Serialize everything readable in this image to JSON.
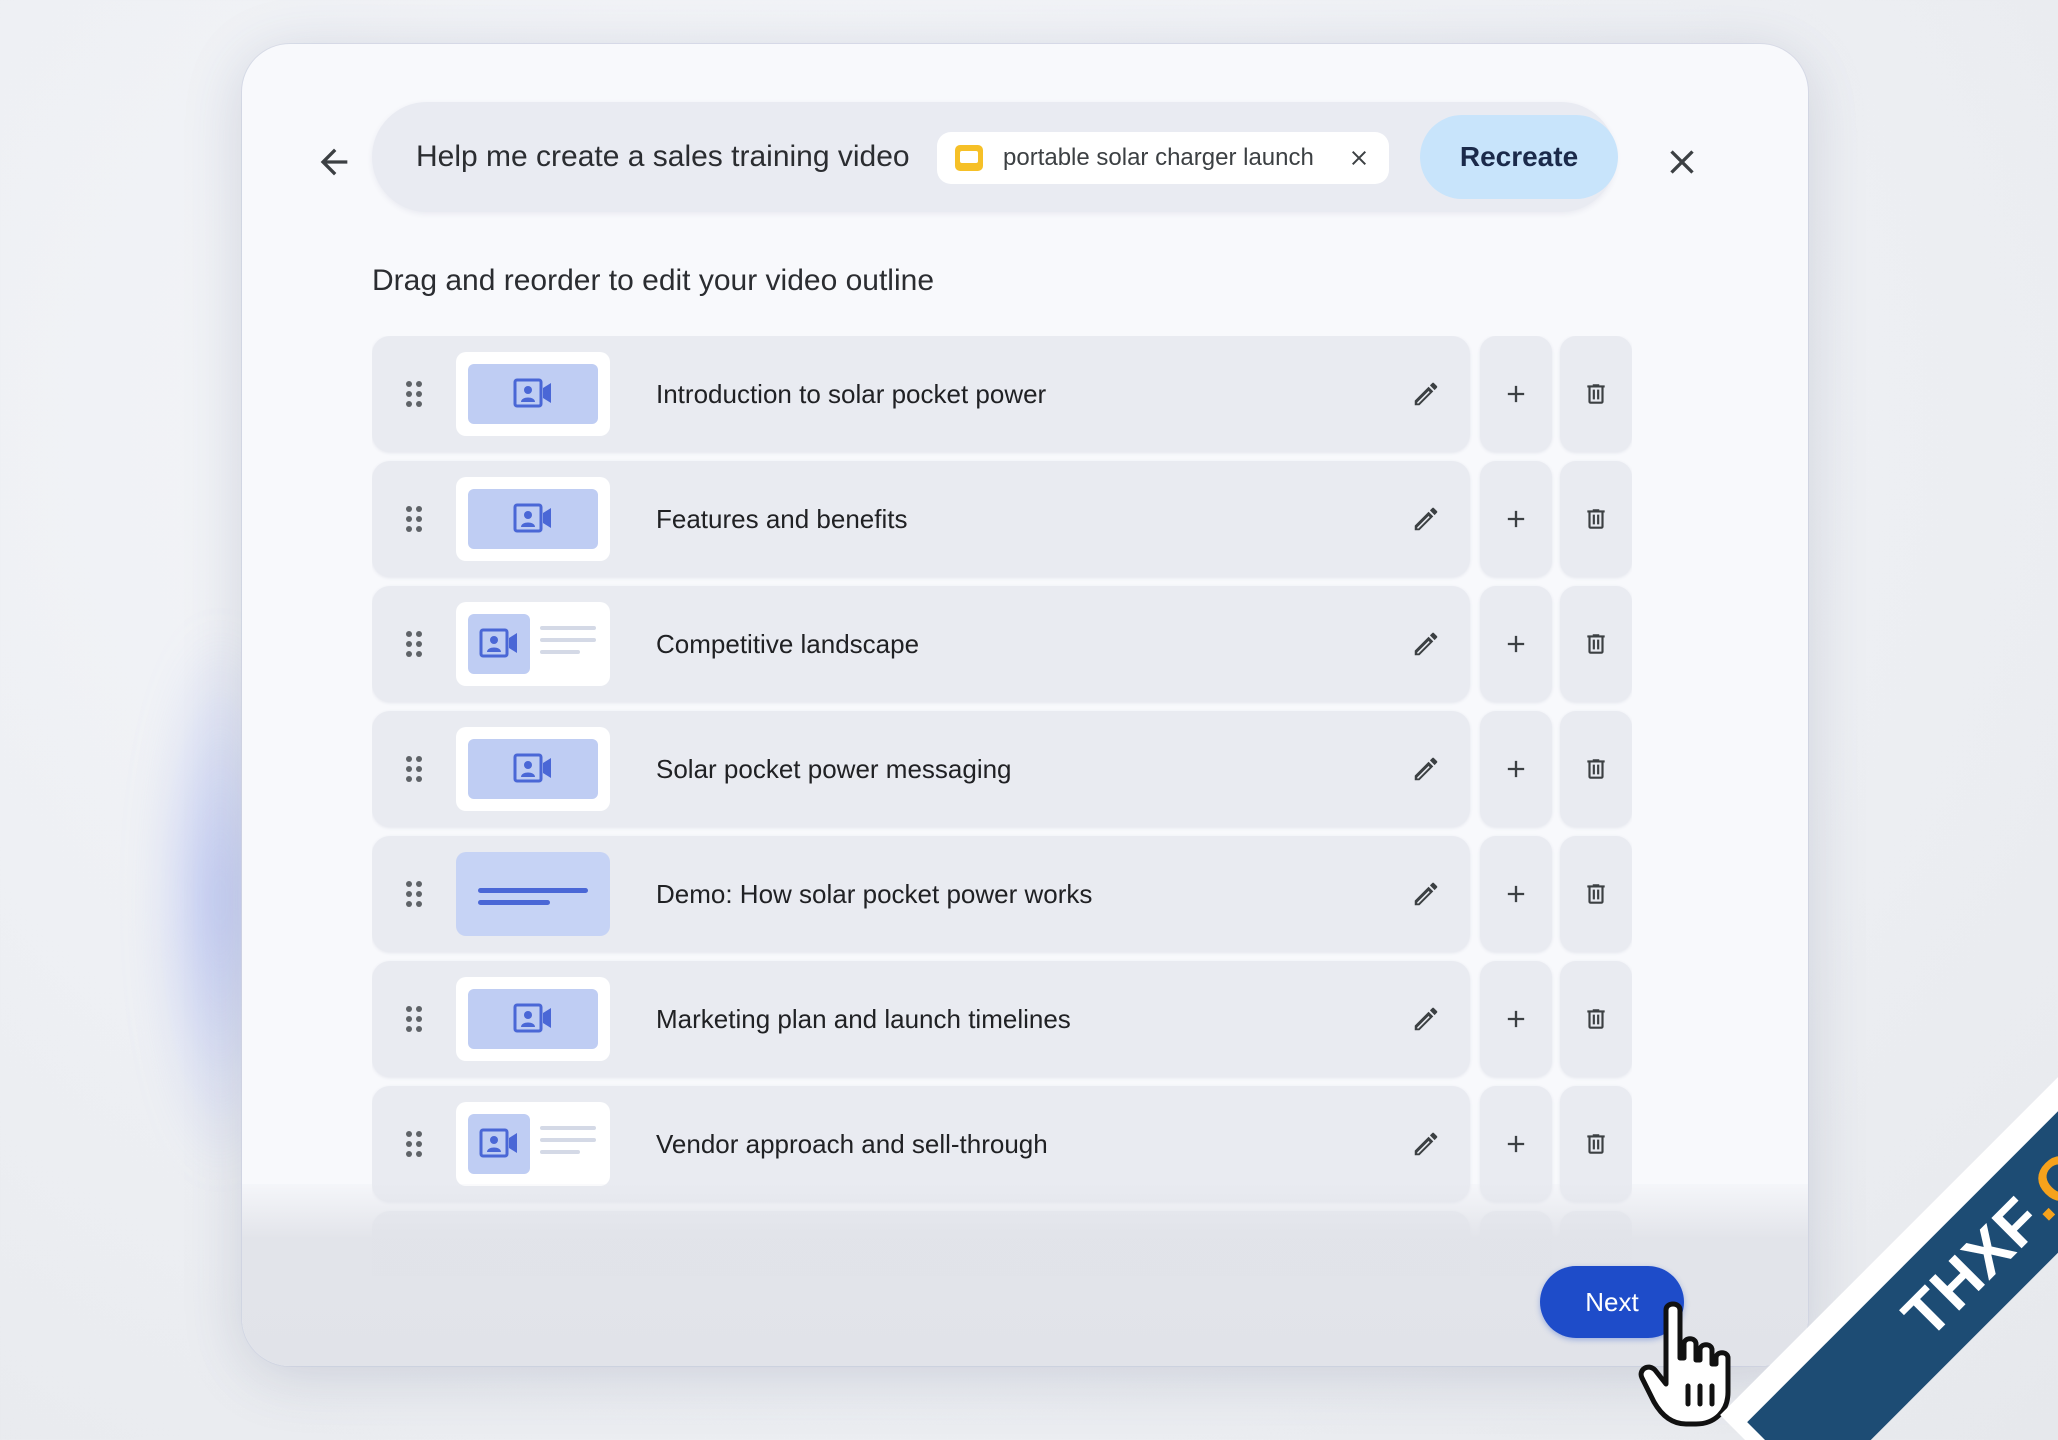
{
  "prompt_bar": {
    "text": "Help me create a sales training video",
    "chip_label": "portable solar charger launch",
    "recreate_label": "Recreate"
  },
  "heading": "Drag and reorder to edit your video outline",
  "outline_items": [
    {
      "title": "Introduction to solar pocket power",
      "thumb": "video-full"
    },
    {
      "title": "Features and benefits",
      "thumb": "video-full"
    },
    {
      "title": "Competitive landscape",
      "thumb": "video-with-text"
    },
    {
      "title": "Solar pocket power messaging",
      "thumb": "video-full"
    },
    {
      "title": "Demo: How solar pocket power works",
      "thumb": "slide-lines"
    },
    {
      "title": "Marketing plan and launch timelines",
      "thumb": "video-full"
    },
    {
      "title": "Vendor approach and sell-through",
      "thumb": "video-with-text"
    }
  ],
  "next_label": "Next",
  "watermark": {
    "main": "THXF",
    "suffix": ".ORG"
  },
  "colors": {
    "accent": "#1e4cc9",
    "recreate_bg": "#c8e4fb",
    "thumb_blue": "#bfcdf3",
    "row_bg": "#e9ebf1",
    "chip_icon": "#f6c027"
  },
  "icons": [
    "back-arrow-icon",
    "close-icon",
    "drag-handle-icon",
    "video-presenter-icon",
    "pencil-icon",
    "plus-icon",
    "trash-icon",
    "hand-cursor-icon"
  ]
}
